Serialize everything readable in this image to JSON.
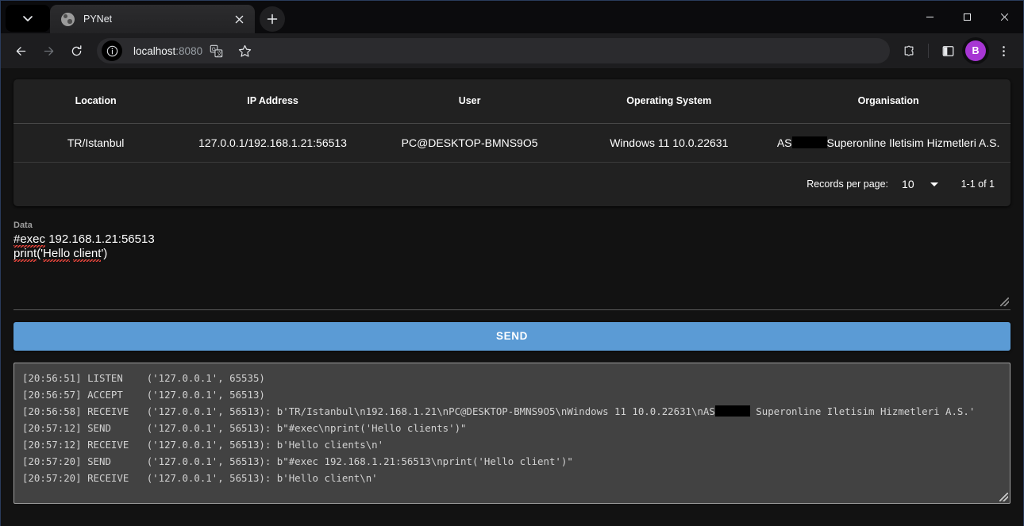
{
  "window": {
    "minimize_label": "—",
    "maximize_label": "□",
    "close_label": "✕"
  },
  "browser": {
    "tab": {
      "title": "PYNet",
      "favicon": "python-logo-icon",
      "close_label": "✕"
    },
    "tab_search_icon": "chevron-down-icon",
    "new_tab_icon": "plus-icon",
    "back_icon": "arrow-left-icon",
    "forward_icon": "arrow-right-icon",
    "reload_icon": "reload-icon",
    "site_info_icon": "info-circle-icon",
    "url_host": "localhost",
    "url_port": ":8080",
    "translate_icon": "translate-icon",
    "bookmark_icon": "star-icon",
    "extensions_icon": "puzzle-piece-icon",
    "side_panel_icon": "side-panel-icon",
    "avatar_initial": "B",
    "avatar_color": "#a736d4",
    "menu_icon": "three-dot-menu-icon"
  },
  "table": {
    "columns": [
      "Location",
      "IP Address",
      "User",
      "Operating System",
      "Organisation"
    ],
    "rows": [
      {
        "location": "TR/Istanbul",
        "ip_address": "127.0.0.1/192.168.1.21:56513",
        "user": "PC@DESKTOP-BMNS9O5",
        "operating_system": "Windows 11 10.0.22631",
        "organisation_prefix": "AS",
        "organisation_suffix": "Superonline Iletisim Hizmetleri A.S.",
        "organisation_redacted": true
      }
    ]
  },
  "paginator": {
    "label": "Records per page:",
    "page_size": "10",
    "dropdown_icon": "caret-down-icon",
    "range": "1-1 of 1"
  },
  "data_field": {
    "label": "Data",
    "line1_token": "#exec",
    "line1_rest": " 192.168.1.21:56513",
    "line2_a": "print",
    "line2_b": "('",
    "line2_c": "Hello",
    "line2_d": " ",
    "line2_e": "client",
    "line2_f": "')",
    "value": "#exec 192.168.1.21:56513\nprint('Hello client')",
    "placeholder": "",
    "resize_icon": "resize-handle-icon"
  },
  "send_button": {
    "label": "SEND",
    "color": "#5b9bd5"
  },
  "log": {
    "resize_icon": "resize-handle-icon",
    "lines": [
      {
        "time": "[20:56:51]",
        "action": "LISTEN  ",
        "detail": "('127.0.0.1', 65535)"
      },
      {
        "time": "[20:56:57]",
        "action": "ACCEPT  ",
        "detail": "('127.0.0.1', 56513)"
      },
      {
        "time": "[20:56:58]",
        "action": "RECEIVE ",
        "detail_a": "('127.0.0.1', 56513): b'TR/Istanbul\\n192.168.1.21\\nPC@DESKTOP-BMNS9O5\\nWindows 11 10.0.22631\\nAS",
        "redacted": true,
        "detail_b": " Superonline Iletisim Hizmetleri A.S.'"
      },
      {
        "time": "[20:57:12]",
        "action": "SEND    ",
        "detail": "('127.0.0.1', 56513): b\"#exec\\nprint('Hello clients')\""
      },
      {
        "time": "[20:57:12]",
        "action": "RECEIVE ",
        "detail": "('127.0.0.1', 56513): b'Hello clients\\n'"
      },
      {
        "time": "[20:57:20]",
        "action": "SEND    ",
        "detail": "('127.0.0.1', 56513): b\"#exec 192.168.1.21:56513\\nprint('Hello client')\""
      },
      {
        "time": "[20:57:20]",
        "action": "RECEIVE ",
        "detail": "('127.0.0.1', 56513): b'Hello client\\n'"
      }
    ]
  }
}
